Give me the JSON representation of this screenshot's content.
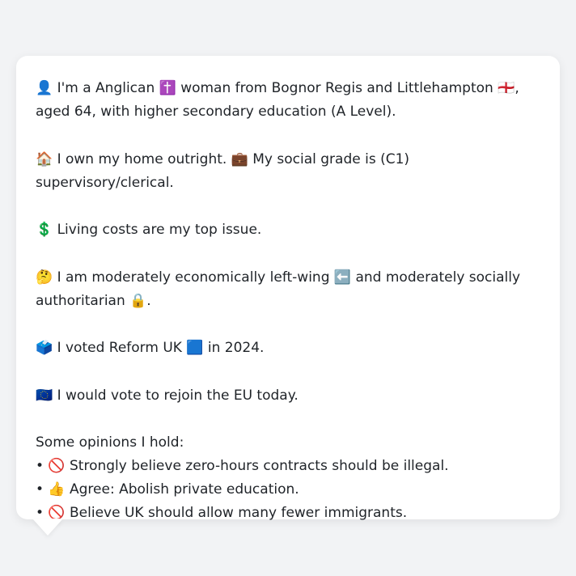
{
  "profile": {
    "intro_line": "👤 I'm a Anglican ✝️ woman from Bognor Regis and Littlehampton 🏴󠁧󠁢󠁥󠁮󠁧󠁿, aged 64, with higher secondary education (A Level).",
    "home_line": "🏠 I own my home outright. 💼 My social grade is (C1) supervisory/clerical.",
    "issue_line": "💲 Living costs are my top issue.",
    "ideology_line": "🤔 I am moderately economically left-wing ⬅️ and moderately socially authoritarian 🔒.",
    "vote_line": "🗳️ I voted Reform UK 🟦 in 2024.",
    "eu_line": "🇪🇺 I would vote to rejoin the EU today.",
    "opinions_heading": "Some opinions I hold:",
    "opinions": [
      "• 🚫 Strongly believe zero-hours contracts should be illegal.",
      "• 👍 Agree: Abolish private education.",
      "• 🚫 Believe UK should allow many fewer immigrants."
    ]
  },
  "colors": {
    "page_background": "#f2f3f5",
    "bubble_background": "#ffffff",
    "text": "#1f2328"
  }
}
